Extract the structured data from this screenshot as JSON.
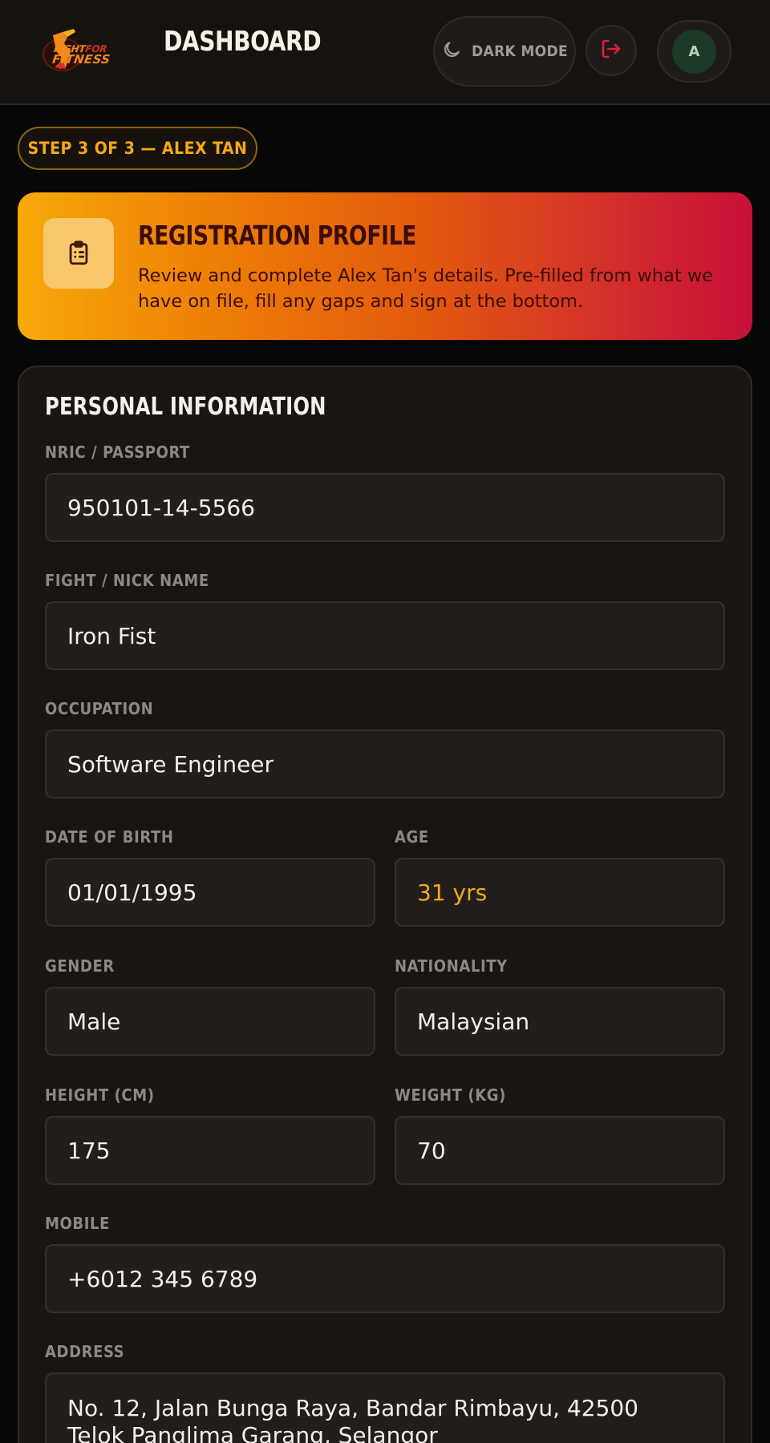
{
  "header": {
    "logo": {
      "line1": "FIGHT",
      "line1_accent": "FOR",
      "line2": "FITNESS"
    },
    "title": "DASHBOARD",
    "dark_mode_label": "DARK MODE",
    "avatar_initial": "A"
  },
  "step_badge": "STEP 3 OF 3 — ALEX TAN",
  "banner": {
    "title": "REGISTRATION PROFILE",
    "description": "Review and complete Alex Tan's details. Pre-filled from what we have on file, fill any gaps and sign at the bottom."
  },
  "personal": {
    "section_title": "PERSONAL INFORMATION",
    "nric": {
      "label": "NRIC / PASSPORT",
      "value": "950101-14-5566"
    },
    "nickname": {
      "label": "FIGHT / NICK NAME",
      "value": "Iron Fist"
    },
    "occupation": {
      "label": "OCCUPATION",
      "value": "Software Engineer"
    },
    "dob": {
      "label": "DATE OF BIRTH",
      "value": "01/01/1995"
    },
    "age": {
      "label": "AGE",
      "value": "31 yrs"
    },
    "gender": {
      "label": "GENDER",
      "value": "Male"
    },
    "nationality": {
      "label": "NATIONALITY",
      "value": "Malaysian"
    },
    "height": {
      "label": "HEIGHT (CM)",
      "value": "175"
    },
    "weight": {
      "label": "WEIGHT (KG)",
      "value": "70"
    },
    "mobile": {
      "label": "MOBILE",
      "value": "+6012 345 6789"
    },
    "address": {
      "label": "ADDRESS",
      "value": "No. 12, Jalan Bunga Raya, Bandar Rimbayu, 42500 Telok Panglima Garang, Selangor"
    }
  },
  "colors": {
    "accent": "#f5a914",
    "logout_icon": "#e0203c",
    "banner_start": "#f7a90a",
    "banner_end": "#c8103a"
  },
  "icons": [
    "moon-icon",
    "logout-icon",
    "clipboard-icon"
  ]
}
